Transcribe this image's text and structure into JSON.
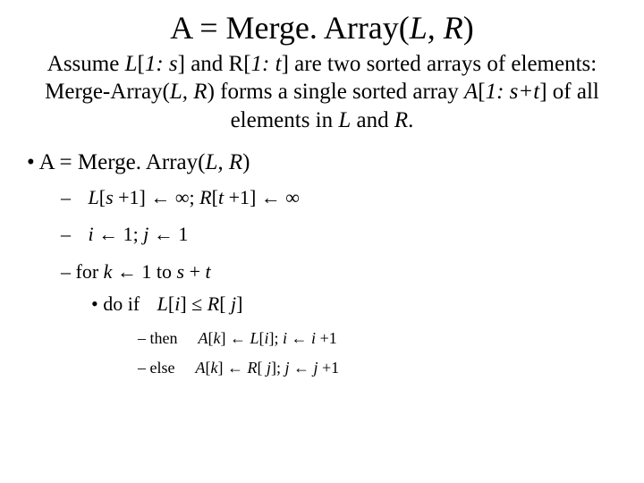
{
  "title": "A = Merge. Array(<span class='italic'>L, R</span>)",
  "subtitle": "Assume <span class='italic'>L</span>[<span class='italic'>1: s</span>] and R[<span class='italic'>1: t</span>] are two sorted arrays of elements: Merge-Array(<span class='italic'>L, R</span>) forms a single sorted array <span class='italic'>A</span>[<span class='italic'>1: s+t</span>] of all elements in <span class='italic'>L</span> and <span class='italic'>R</span>.",
  "bullet_main": "A = Merge. Array(<span class='italic'>L, R</span>)",
  "sub1": "<span class='math-gap'></span><span class='italic expr'>L</span>[<span class='italic'>s</span> +1] ← ∞; <span class='italic'>R</span>[<span class='italic'>t</span> +1] ← ∞",
  "sub2": "<span class='math-gap'></span><span class='italic'>i</span> ← 1; <span class='italic'>j</span> ← 1",
  "sub3": "for <span class='italic'>k</span> ← 1 to <span class='italic'>s</span> + <span class='italic'>t</span>",
  "sub3_do": "do if <span class='math-gap'></span><span class='italic'>L</span>[<span class='italic'>i</span>] ≤ <span class='italic'>R</span>[ <span class='italic'>j</span>]",
  "then_line": "then <span class='math-gap'></span> <span class='italic'>A</span>[<span class='italic'>k</span>] ← <span class='italic'>L</span>[<span class='italic'>i</span>]; <span class='italic'>i</span> ← <span class='italic'>i</span> +1",
  "else_line": "else <span class='math-gap'></span> <span class='italic'>A</span>[<span class='italic'>k</span>] ← <span class='italic'>R</span>[ <span class='italic'>j</span>]; <span class='italic'>j</span> ← <span class='italic'>j</span> +1"
}
